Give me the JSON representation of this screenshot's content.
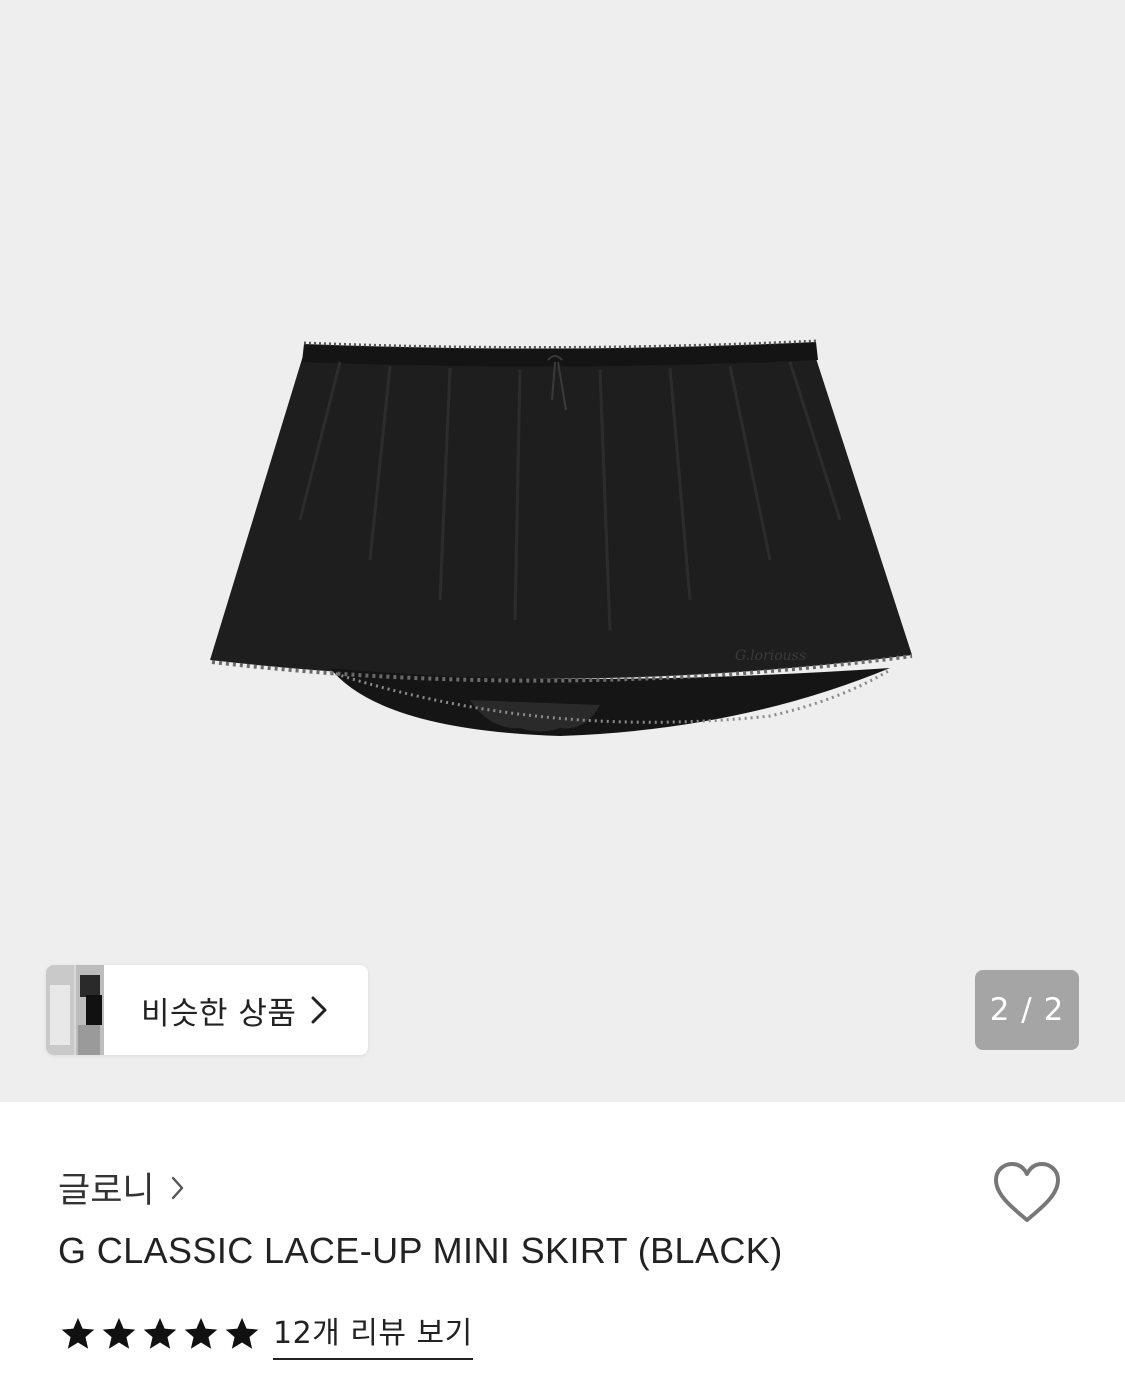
{
  "gallery": {
    "image_icon": "black-mini-skirt-photo",
    "background_color": "#eeeeef",
    "pager": {
      "current": "2",
      "separator": "/",
      "total": "2",
      "text": "2 / 2"
    },
    "similar_products": {
      "label": "비슷한 상품",
      "thumb_icon": "similar-product-thumbnail",
      "chevron_icon": "chevron-right-icon"
    }
  },
  "product": {
    "brand": "글로니",
    "brand_chevron_icon": "chevron-right-icon",
    "title": "G CLASSIC LACE-UP MINI SKIRT (BLACK)",
    "like_icon": "heart-outline-icon",
    "rating": {
      "stars": 5,
      "max_stars": 5,
      "star_color": "#111111"
    },
    "review_link": "12개 리뷰 보기"
  }
}
